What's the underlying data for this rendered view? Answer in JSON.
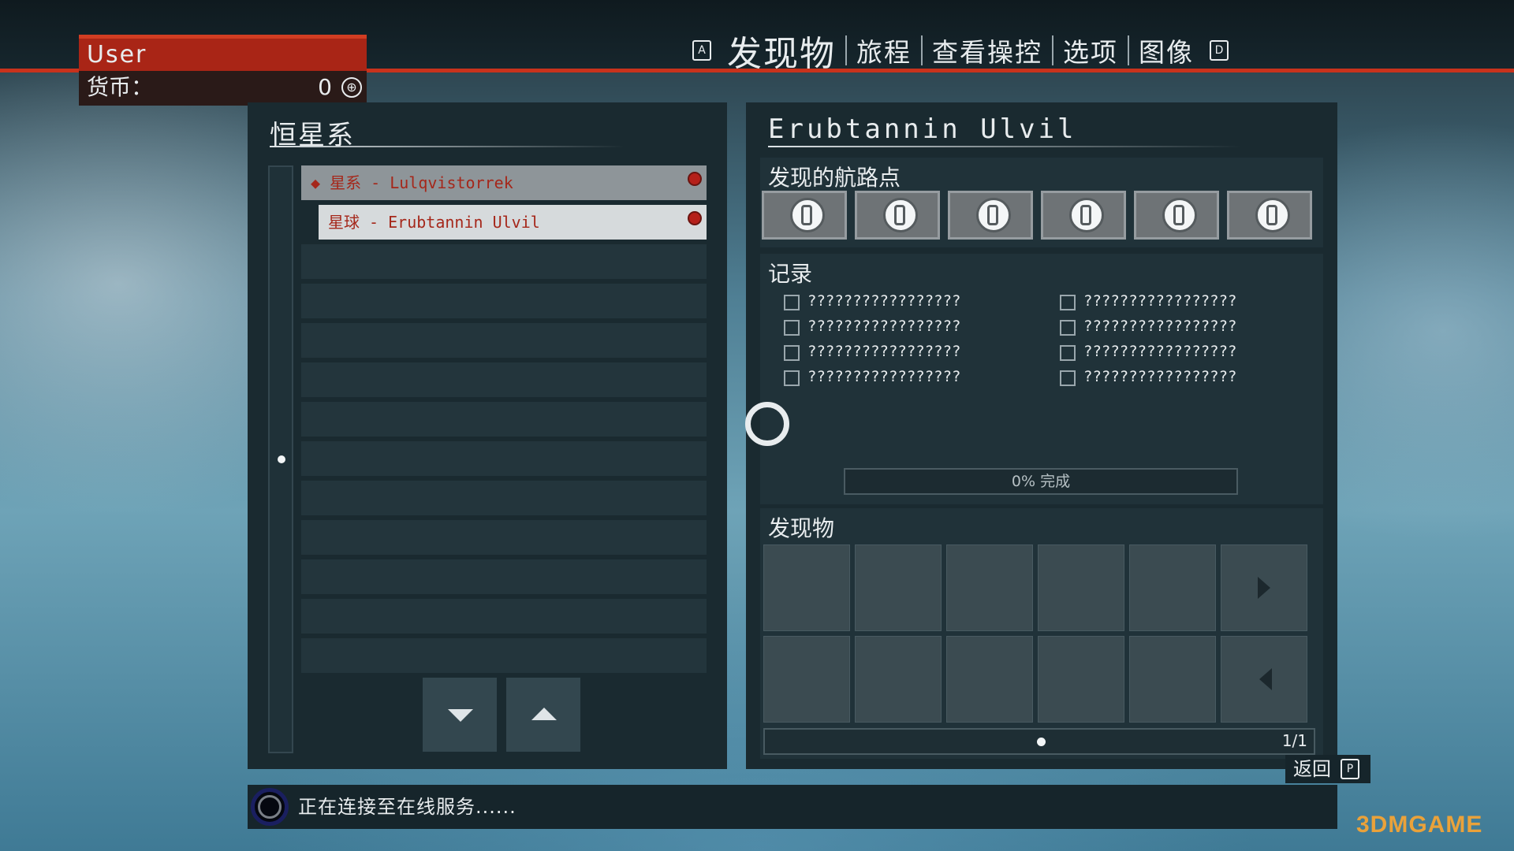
{
  "header": {
    "user_name": "User",
    "currency_label": "货币：",
    "currency_value": "0",
    "currency_icon": "⊕",
    "tab_left_key": "A",
    "tab_right_key": "D",
    "tabs": [
      {
        "label": "发现物",
        "active": true
      },
      {
        "label": "旅程",
        "active": false
      },
      {
        "label": "查看操控",
        "active": false
      },
      {
        "label": "选项",
        "active": false
      },
      {
        "label": "图像",
        "active": false
      }
    ]
  },
  "left_panel": {
    "title": "恒星系",
    "items": [
      {
        "label": "◆ 星系 - Lulqvistorrek",
        "type": "system"
      },
      {
        "label": "星球 - Erubtannin Ulvil",
        "type": "planet"
      }
    ]
  },
  "right_panel": {
    "title": "Erubtannin Ulvil",
    "waypoints_title": "发现的航路点",
    "waypoint_count": 6,
    "records_title": "记录",
    "records": [
      "?????????????????",
      "?????????????????",
      "?????????????????",
      "?????????????????",
      "?????????????????",
      "?????????????????",
      "?????????????????",
      "?????????????????"
    ],
    "progress_text": "0% 完成",
    "progress_value": 0,
    "discoveries_title": "发现物",
    "page_indicator": "1/1"
  },
  "footer": {
    "back_label": "返回",
    "back_key": "P",
    "status_text": "正在连接至在线服务......",
    "watermark": "3DMGAME"
  },
  "colors": {
    "accent_red": "#c8321c",
    "panel_bg": "#1a2a30"
  }
}
